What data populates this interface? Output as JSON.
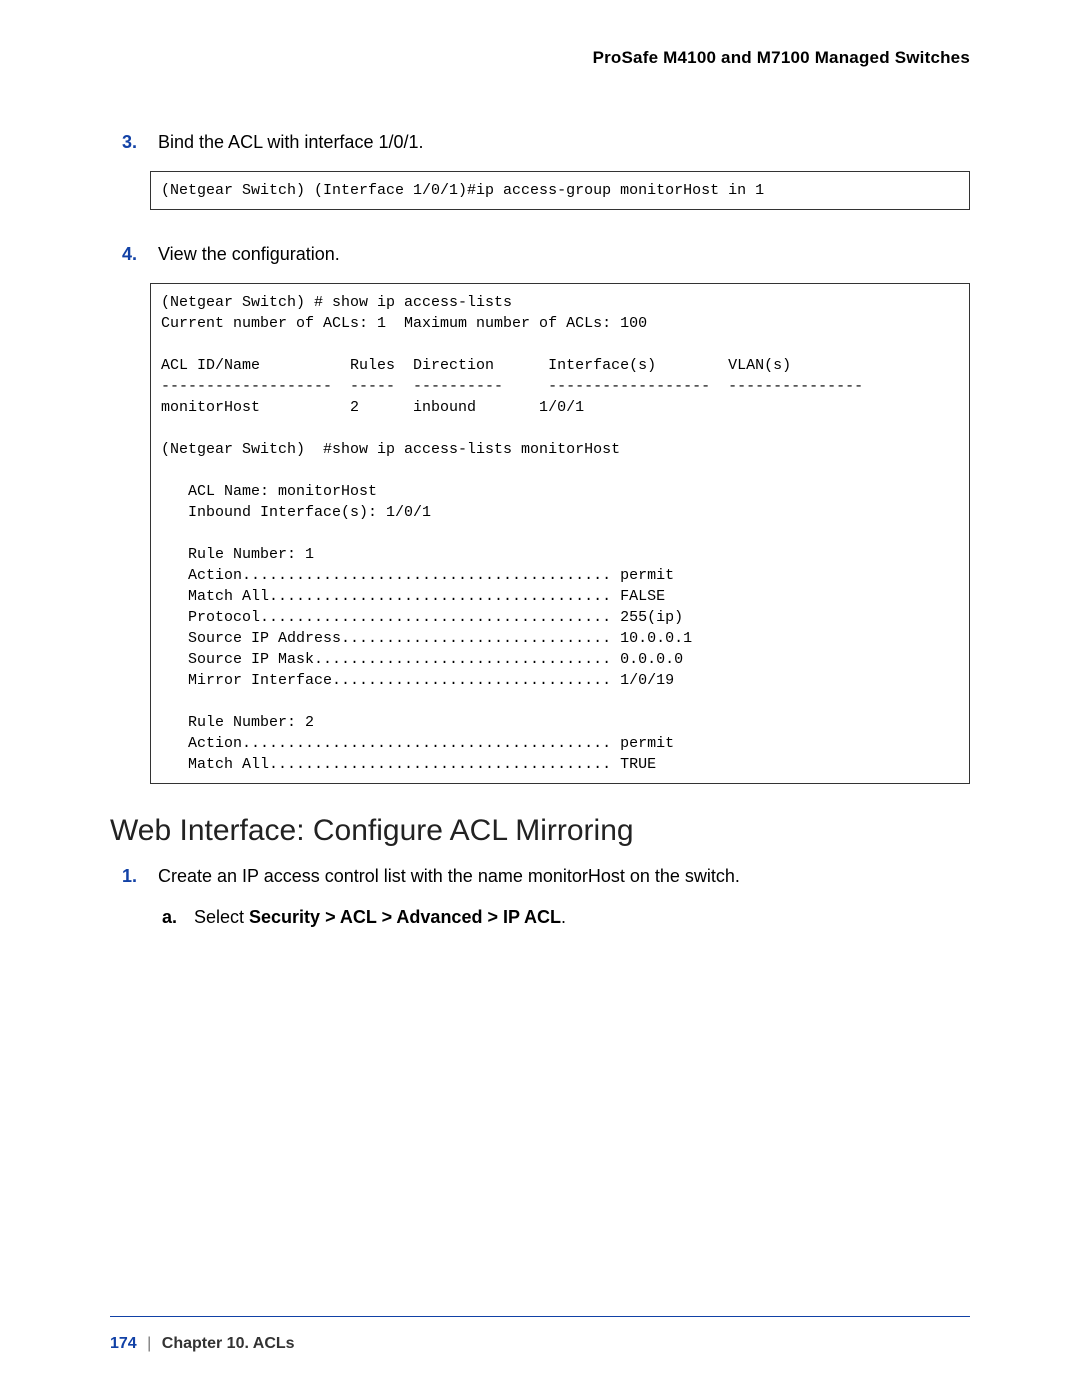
{
  "header": {
    "title": "ProSafe M4100 and M7100 Managed Switches"
  },
  "steps": {
    "s3": {
      "num": "3.",
      "text": "Bind the ACL with interface 1/0/1."
    },
    "s4": {
      "num": "4.",
      "text": "View the configuration."
    }
  },
  "code1": "(Netgear Switch) (Interface 1/0/1)#ip access-group monitorHost in 1",
  "code2": "(Netgear Switch) # show ip access-lists\nCurrent number of ACLs: 1  Maximum number of ACLs: 100\n\nACL ID/Name          Rules  Direction      Interface(s)        VLAN(s)\n-------------------  -----  ----------     ------------------  ---------------\nmonitorHost          2      inbound       1/0/1\n\n(Netgear Switch)  #show ip access-lists monitorHost\n\n   ACL Name: monitorHost\n   Inbound Interface(s): 1/0/1\n\n   Rule Number: 1\n   Action......................................... permit\n   Match All...................................... FALSE\n   Protocol....................................... 255(ip)\n   Source IP Address.............................. 10.0.0.1\n   Source IP Mask................................. 0.0.0.0\n   Mirror Interface............................... 1/0/19\n\n   Rule Number: 2\n   Action......................................... permit\n   Match All...................................... TRUE",
  "section": {
    "title": "Web Interface: Configure ACL Mirroring",
    "step1": {
      "num": "1.",
      "text": "Create an IP access control list with the name monitorHost on the switch."
    },
    "sub_a": {
      "num": "a.",
      "prefix": "Select ",
      "boldpath": "Security > ACL > Advanced > IP ACL",
      "suffix": "."
    }
  },
  "footer": {
    "page": "174",
    "sep": "|",
    "chapter": "Chapter 10.  ACLs"
  }
}
